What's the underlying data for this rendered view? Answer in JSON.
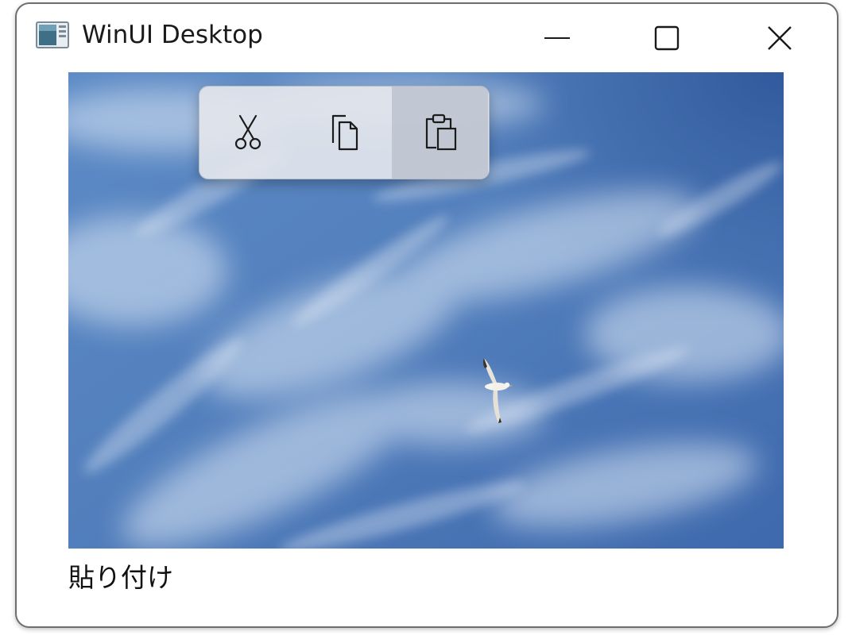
{
  "window": {
    "title": "WinUI Desktop",
    "caption_buttons": [
      "minimize-icon",
      "maximize-icon",
      "close-icon"
    ]
  },
  "image": {
    "subject": "seagull-in-blue-sky-photo"
  },
  "command_bar_flyout": {
    "buttons": [
      {
        "icon": "cut-icon",
        "state": "normal"
      },
      {
        "icon": "copy-icon",
        "state": "normal"
      },
      {
        "icon": "paste-icon",
        "state": "hover"
      }
    ]
  },
  "status": {
    "text": "貼り付け"
  },
  "colors": {
    "sky": "#4a78b8",
    "flyout_bg": "#e2e5ec",
    "window_border": "#6e6e6e"
  }
}
